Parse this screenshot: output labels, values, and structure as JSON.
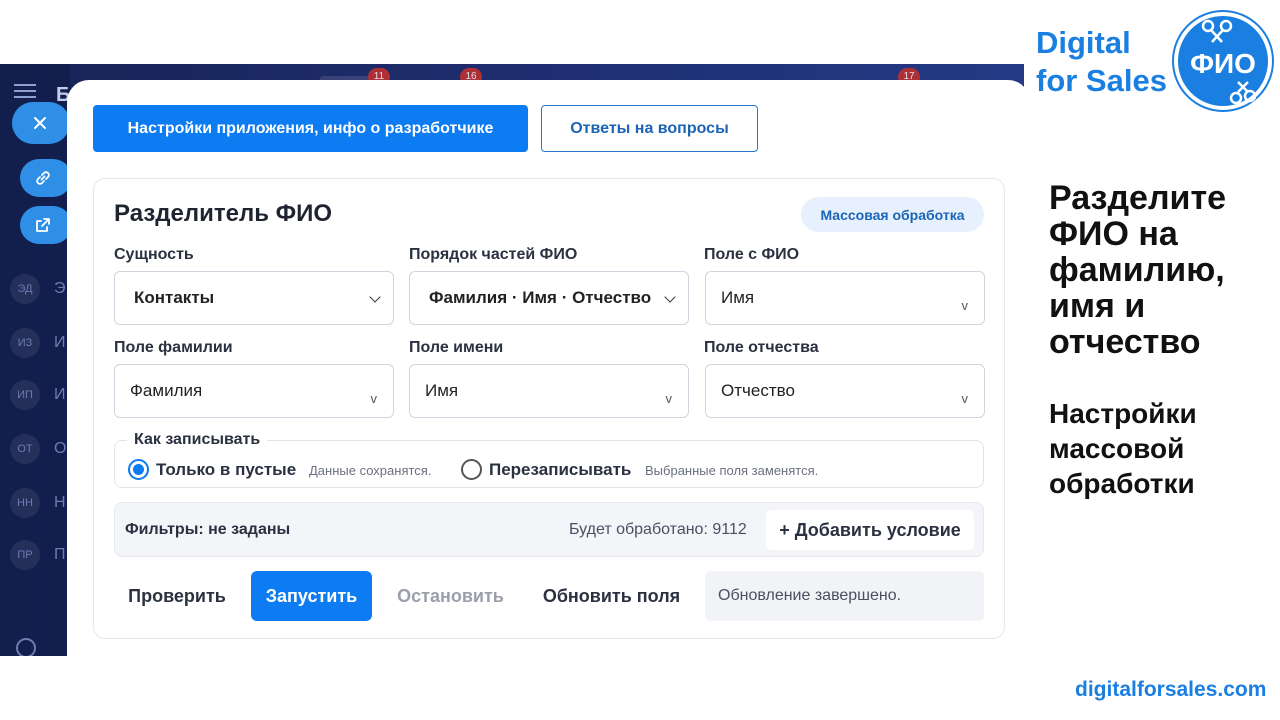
{
  "crm": {
    "header_letter": "Б",
    "badges": [
      "11",
      "16",
      "17"
    ],
    "nav": [
      {
        "abbr": "ЭД",
        "text": "Э"
      },
      {
        "abbr": "ИЗ",
        "text": "И"
      },
      {
        "abbr": "ИП",
        "text": "И"
      },
      {
        "abbr": "ОТ",
        "text": "О"
      },
      {
        "abbr": "НН",
        "text": "Н"
      },
      {
        "abbr": "ПР",
        "text": "П"
      }
    ]
  },
  "top_buttons": {
    "settings_label": "Настройки приложения, инфо о разработчике",
    "faq_label": "Ответы на вопросы"
  },
  "card": {
    "title": "Разделитель ФИО",
    "mode_pill": "Массовая обработка",
    "fields": {
      "entity": {
        "label": "Сущность",
        "value": "Контакты"
      },
      "order": {
        "label": "Порядок частей ФИО",
        "value": "Фамилия · Имя · Отчество"
      },
      "fio_field": {
        "label": "Поле с ФИО",
        "value": "Имя"
      },
      "last_name": {
        "label": "Поле фамилии",
        "value": "Фамилия"
      },
      "first_name": {
        "label": "Поле имени",
        "value": "Имя"
      },
      "patronymic": {
        "label": "Поле отчества",
        "value": "Отчество"
      }
    },
    "write_mode": {
      "legend": "Как записывать",
      "options": [
        {
          "label": "Только в пустые",
          "hint": "Данные сохранятся.",
          "selected": true
        },
        {
          "label": "Перезаписывать",
          "hint": "Выбранные поля заменятся.",
          "selected": false
        }
      ]
    },
    "filters": {
      "text": "Фильтры: не заданы",
      "count": "Будет обработано: 9112",
      "add_label": "+ Добавить условие"
    },
    "actions": {
      "check": "Проверить",
      "run": "Запустить",
      "stop": "Остановить",
      "refresh": "Обновить поля",
      "status": "Обновление завершено."
    }
  },
  "promo": {
    "brand_line1": "Digital",
    "brand_line2": "for Sales",
    "logo_text": "ФИО",
    "heading": "Разделите ФИО на фамилию, имя и отчество",
    "subheading": "Настройки массовой обработки",
    "website": "digitalforsales.com"
  },
  "colors": {
    "primary": "#0d7bf2",
    "brand": "#1a7fe0",
    "crm_background": "#1d2b6a"
  }
}
